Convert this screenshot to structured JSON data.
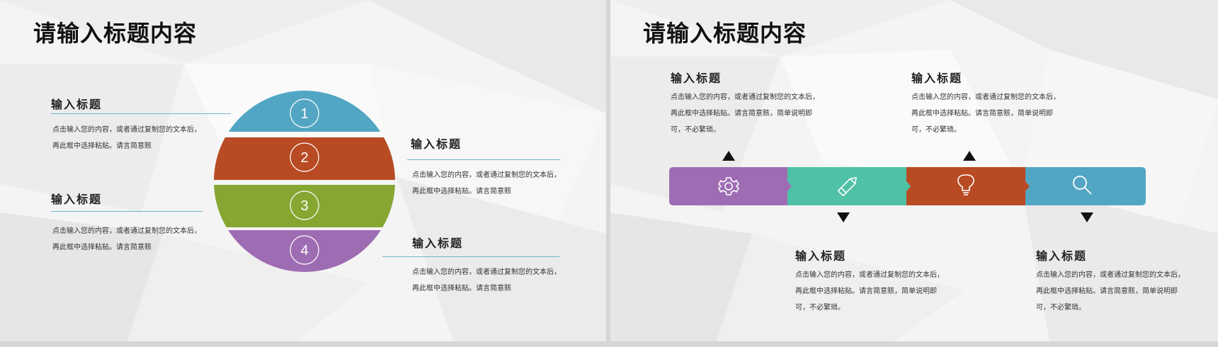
{
  "slide1": {
    "title": "请输入标题内容",
    "blocks": [
      {
        "heading": "输入标题",
        "lines": [
          "点击输入您的内容，或者通过复制您的文本后，",
          "再此框中选择粘贴。请言简意赅"
        ]
      },
      {
        "heading": "输入标题",
        "lines": [
          "点击输入您的内容，或者通过复制您的文本后，",
          "再此框中选择粘贴。请言简意赅"
        ]
      },
      {
        "heading": "输入标题",
        "lines": [
          "点击输入您的内容，或者通过复制您的文本后，",
          "再此框中选择粘贴。请言简意赅"
        ]
      },
      {
        "heading": "输入标题",
        "lines": [
          "点击输入您的内容，或者通过复制您的文本后，",
          "再此框中选择粘贴。请言简意赅"
        ]
      }
    ],
    "bands": [
      {
        "number": "1",
        "color": "#52a6c3"
      },
      {
        "number": "2",
        "color": "#b84a24"
      },
      {
        "number": "3",
        "color": "#86a632"
      },
      {
        "number": "4",
        "color": "#9e6cb3"
      }
    ]
  },
  "slide2": {
    "title": "请输入标题内容",
    "blocks": [
      {
        "heading": "输入标题",
        "lines": [
          "点击输入您的内容，或者通过复制您的文本后，",
          "再此框中选择粘贴。请言简意赅，简单说明即",
          "可，不必繁琐。"
        ]
      },
      {
        "heading": "输入标题",
        "lines": [
          "点击输入您的内容，或者通过复制您的文本后，",
          "再此框中选择粘贴。请言简意赅，简单说明即",
          "可，不必繁琐。"
        ]
      },
      {
        "heading": "输入标题",
        "lines": [
          "点击输入您的内容，或者通过复制您的文本后，",
          "再此框中选择粘贴。请言简意赅，简单说明即",
          "可，不必繁琐。"
        ]
      },
      {
        "heading": "输入标题",
        "lines": [
          "点击输入您的内容，或者通过复制您的文本后，",
          "再此框中选择粘贴。请言简意赅，简单说明即",
          "可，不必繁琐。"
        ]
      }
    ],
    "segments": [
      {
        "icon": "gear-icon",
        "color": "#9e6cb3"
      },
      {
        "icon": "pencil-icon",
        "color": "#4fc1a6"
      },
      {
        "icon": "lightbulb-icon",
        "color": "#b84a24"
      },
      {
        "icon": "magnifier-icon",
        "color": "#52a6c3"
      }
    ]
  }
}
